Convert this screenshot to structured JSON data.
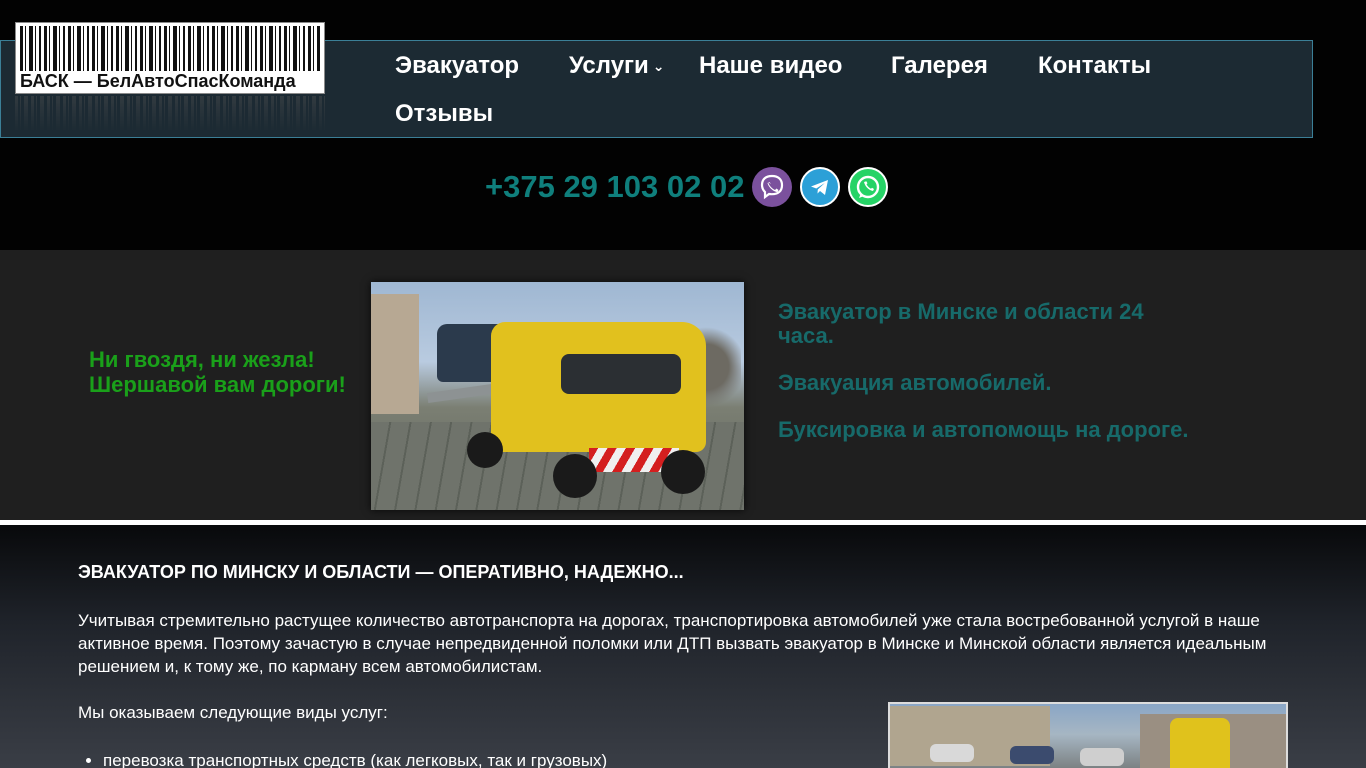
{
  "logo": {
    "caption": "БАСК — БелАвтоСпасКоманда"
  },
  "menu": {
    "items": [
      {
        "label": "Эвакуатор"
      },
      {
        "label": "Услуги",
        "chevron": "⌄"
      },
      {
        "label": "Наше видео"
      },
      {
        "label": "Галерея"
      },
      {
        "label": "Контакты"
      },
      {
        "label": "Отзывы"
      }
    ]
  },
  "contact": {
    "phone": "+375 29 103 02 02",
    "messengers": [
      "viber-icon",
      "telegram-icon",
      "whatsapp-icon"
    ]
  },
  "hero": {
    "slogan": "Ни гвоздя, ни жезла! Шершавой вам дороги!",
    "features": [
      "Эвакуатор в Минске и области 24 часа.",
      "Эвакуация автомобилей.",
      "Буксировка и автопомощь на дороге."
    ]
  },
  "content": {
    "heading": "ЭВАКУАТОР ПО МИНСКУ И ОБЛАСТИ — ОПЕРАТИВНО, НАДЕЖНО...",
    "paragraph": "Учитывая стремительно растущее количество автотранспорта на дорогах, транспортировка автомобилей уже стала востребованной услугой в наше активное время. Поэтому зачастую в случае непредвиденной поломки или ДТП вызвать эвакуатор в Минске и Минской области является идеальным решением и, к тому же, по карману всем автомобилистам.",
    "lead": "Мы оказываем следующие виды услуг:",
    "bullets": [
      "перевозка транспортных средств (как легковых, так и грузовых)"
    ]
  },
  "colors": {
    "phone": "#0f7f7c",
    "slogan": "#1aa01a",
    "features": "#176a6a",
    "nav_border": "#3b7f97",
    "nav_bg": "#1c2a33"
  }
}
